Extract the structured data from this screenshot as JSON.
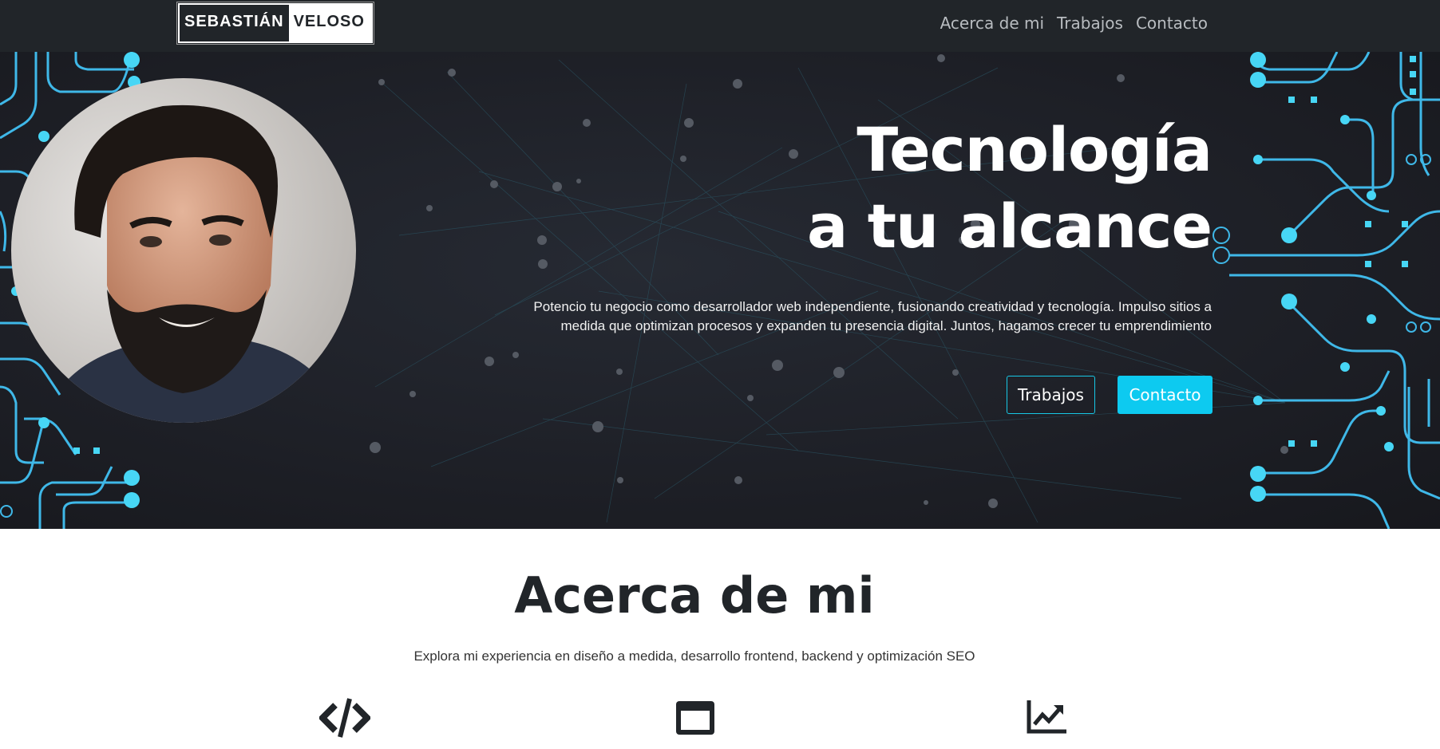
{
  "navbar": {
    "logo_first": "SEBASTIÁN",
    "logo_last": "VELOSO",
    "links": [
      "Acerca de mi",
      "Trabajos",
      "Contacto"
    ]
  },
  "hero": {
    "title_line1": "Tecnología",
    "title_line2": "a tu alcance",
    "subtitle_line1": "Potencio tu negocio como desarrollador web independiente, fusionando creatividad y tecnología. Impulso sitios a",
    "subtitle_line2": "medida que optimizan procesos y expanden tu presencia digital. Juntos, hagamos crecer tu emprendimiento",
    "btn_works": "Trabajos",
    "btn_contact": "Contacto",
    "avatar_icon": "portrait-photo"
  },
  "about": {
    "title": "Acerca de mi",
    "subtitle": "Explora mi experiencia en diseño a medida, desarrollo frontend, backend y optimización SEO",
    "icons": [
      "code-icon",
      "browser-window-icon",
      "chart-line-icon"
    ]
  },
  "colors": {
    "navbar_bg": "#212529",
    "accent_cyan": "#0dcaf0",
    "circuit_cyan": "#41c7ef",
    "hero_bg": "#1e2027"
  }
}
